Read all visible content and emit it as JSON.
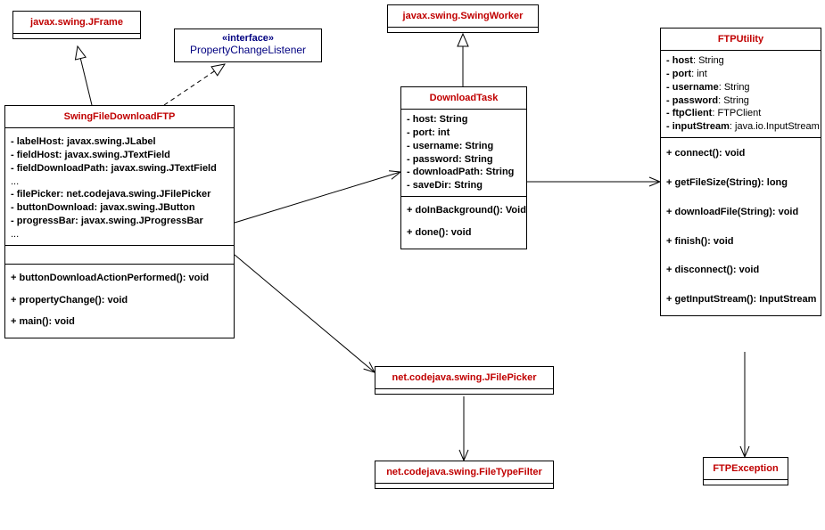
{
  "jframe": {
    "title": "javax.swing.JFrame"
  },
  "pcl": {
    "stereotype": "«interface»",
    "name": "PropertyChangeListener"
  },
  "swingworker": {
    "title": "javax.swing.SwingWorker"
  },
  "ftputility": {
    "title": "FTPUtility",
    "attrs": {
      "host": "- host: String",
      "port": "- port: int",
      "username": "- username: String",
      "password": "- password: String",
      "ftpClient": "- ftpClient: FTPClient",
      "inputStream": "- inputStream: java.io.InputStream"
    },
    "ops": {
      "connect": "+ connect(): void",
      "getFileSize": "+ getFileSize(String): long",
      "downloadFile": "+ downloadFile(String): void",
      "finish": "+ finish(): void",
      "disconnect": "+ disconnect(): void",
      "getInputStream": "+ getInputStream(): InputStream"
    }
  },
  "swingFileDownloadFTP": {
    "title": "SwingFileDownloadFTP",
    "attrs": {
      "labelHost": "- labelHost: javax.swing.JLabel",
      "fieldHost": "- fieldHost: javax.swing.JTextField",
      "fieldDownloadPath": "- fieldDownloadPath: javax.swing.JTextField",
      "ellipsis1": "...",
      "filePicker": "- filePicker: net.codejava.swing.JFilePicker",
      "buttonDownload": "- buttonDownload: javax.swing.JButton",
      "progressBar": "- progressBar: javax.swing.JProgressBar",
      "ellipsis2": "..."
    },
    "ops": {
      "buttonDownloadActionPerformed": "+ buttonDownloadActionPerformed(): void",
      "propertyChange": "+ propertyChange(): void",
      "main": "+ main(): void"
    }
  },
  "downloadTask": {
    "title": "DownloadTask",
    "attrs": {
      "host": "- host: String",
      "port": "- port: int",
      "username": "- username: String",
      "password": "- password: String",
      "downloadPath": "- downloadPath: String",
      "saveDir": "- saveDir: String"
    },
    "ops": {
      "doInBackground": "+ doInBackground(): Void",
      "done": "+ done(): void"
    }
  },
  "jfilePicker": {
    "title": "net.codejava.swing.JFilePicker"
  },
  "fileTypeFilter": {
    "title": "net.codejava.swing.FileTypeFilter"
  },
  "ftpException": {
    "title": "FTPException"
  }
}
